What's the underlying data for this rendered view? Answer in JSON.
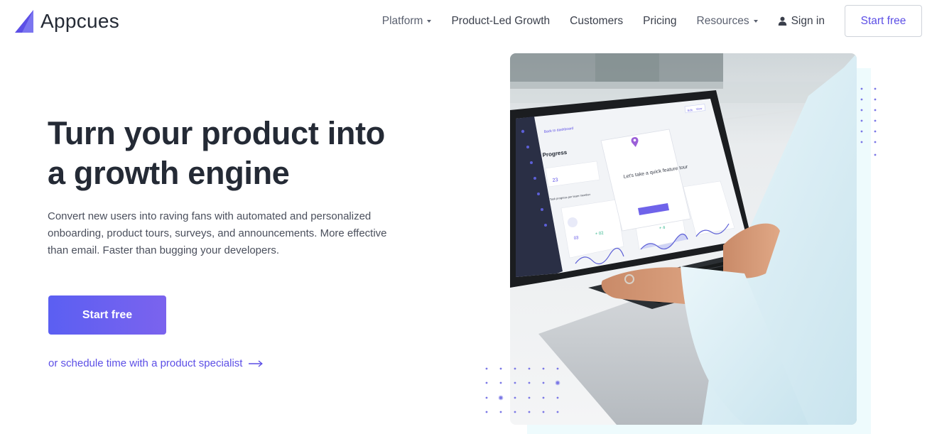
{
  "brand": {
    "name": "Appcues",
    "color": "#5c4fe6"
  },
  "nav": {
    "items": [
      {
        "label": "Platform",
        "has_dropdown": true
      },
      {
        "label": "Product-Led Growth",
        "has_dropdown": false
      },
      {
        "label": "Customers",
        "has_dropdown": false
      },
      {
        "label": "Pricing",
        "has_dropdown": false
      },
      {
        "label": "Resources",
        "has_dropdown": true
      }
    ],
    "sign_in": "Sign in",
    "start_free": "Start free"
  },
  "hero": {
    "title_line1": "Turn your product into",
    "title_line2": "a growth engine",
    "subtitle": "Convert new users into raving fans with automated and personalized onboarding, product tours, surveys, and announcements. More effective than email. Faster than bugging your developers.",
    "cta_label": "Start free",
    "schedule_link": "or schedule time with a product specialist"
  },
  "screen": {
    "progress_heading": "Progress",
    "modal_title": "Let's take a quick feature tour",
    "back_link": "Back to dashboard",
    "tab_a": "Edit",
    "tab_b": "View",
    "stat_value": "23",
    "card_value_1": "03",
    "card_value_2": "+ 02",
    "card_value_3": "+ 4",
    "section_label": "Task progress per team member"
  },
  "colors": {
    "accent": "#5c4fe6",
    "button_gradient_start": "#5b5ff2",
    "button_gradient_end": "#7b63ee",
    "panel_bg": "#eefbfd"
  },
  "icons": [
    "appcues-logo-icon",
    "caret-down-icon",
    "person-icon",
    "arrow-right-icon",
    "location-pin-icon"
  ]
}
